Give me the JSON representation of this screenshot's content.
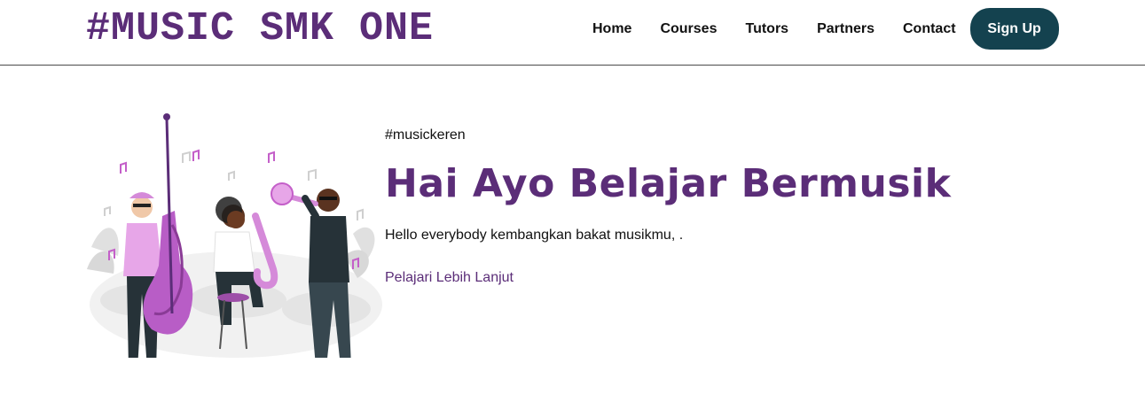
{
  "brand": {
    "logo_text": "#MUSIC SMK ONE"
  },
  "nav": {
    "items": [
      {
        "label": "Home"
      },
      {
        "label": "Courses"
      },
      {
        "label": "Tutors"
      },
      {
        "label": "Partners"
      },
      {
        "label": "Contact"
      }
    ],
    "signup_label": "Sign Up"
  },
  "hero": {
    "tag": "#musickeren",
    "title": "Hai Ayo Belajar Bermusik",
    "description": "Hello everybody kembangkan bakat musikmu, .",
    "cta_label": "Pelajari Lebih Lanjut",
    "illustration_icon": "music-band-illustration"
  },
  "colors": {
    "brand_purple": "#5b2d78",
    "button_teal": "#14424f",
    "text_dark": "#111111",
    "accent_pink": "#c45fc9"
  }
}
